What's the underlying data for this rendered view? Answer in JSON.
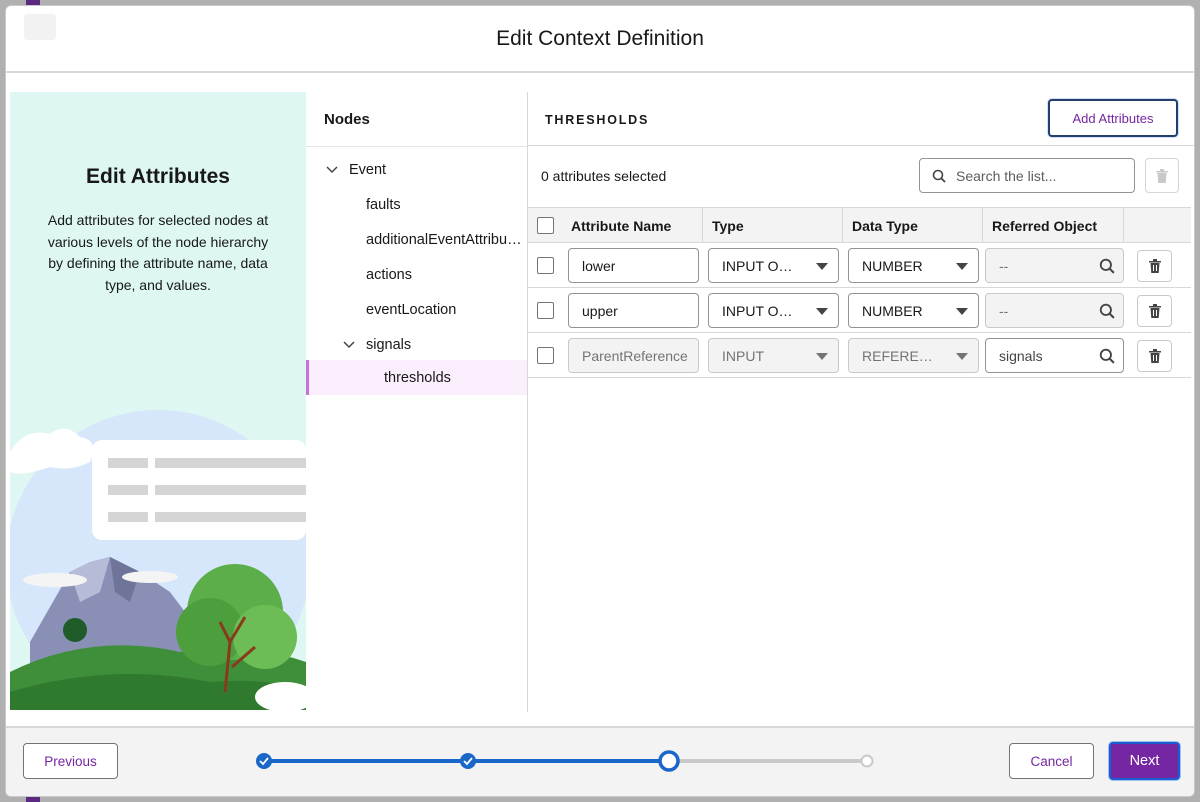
{
  "modal": {
    "title": "Edit Context Definition"
  },
  "illustration": {
    "title": "Edit Attributes",
    "description": "Add attributes for selected nodes at various levels of the node hierarchy by defining the attribute name, data type, and values."
  },
  "nodes": {
    "heading": "Nodes",
    "items": [
      {
        "label": "Event",
        "expanded": true,
        "level": 0
      },
      {
        "label": "faults",
        "level": 1
      },
      {
        "label": "additionalEventAttributes",
        "level": 1
      },
      {
        "label": "actions",
        "level": 1
      },
      {
        "label": "eventLocation",
        "level": 1
      },
      {
        "label": "signals",
        "expanded": true,
        "level": 1
      },
      {
        "label": "thresholds",
        "level": 2,
        "selected": true
      }
    ]
  },
  "main": {
    "section_title": "THRESHOLDS",
    "add_attributes_label": "Add Attributes",
    "selected_count": "0 attributes selected",
    "search_placeholder": "Search the list...",
    "columns": [
      "Attribute Name",
      "Type",
      "Data Type",
      "Referred Object"
    ],
    "rows": [
      {
        "name": "lower",
        "type": "INPUT OUTPUT",
        "data_type": "NUMBER",
        "referred": "--",
        "disabled": false
      },
      {
        "name": "upper",
        "type": "INPUT OUTPUT",
        "data_type": "NUMBER",
        "referred": "--",
        "disabled": false
      },
      {
        "name": "ParentReference",
        "type": "INPUT",
        "data_type": "REFERENCE",
        "referred": "signals",
        "disabled": true
      }
    ]
  },
  "footer": {
    "previous_label": "Previous",
    "cancel_label": "Cancel",
    "next_label": "Next",
    "progress": {
      "total_steps": 4,
      "current_step": 3
    }
  },
  "colors": {
    "brand": "#7526a2",
    "progress": "#1b66c9",
    "selected_node_bg": "#fbeffd",
    "illustration_bg": "#def7f2"
  }
}
